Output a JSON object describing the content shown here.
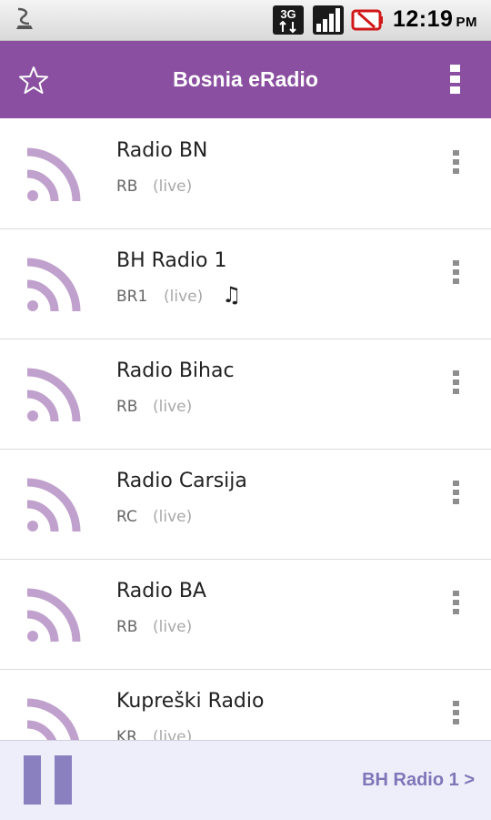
{
  "status_bar": {
    "time": "12:19",
    "ampm": "PM",
    "network": "3G"
  },
  "action_bar": {
    "title": "Bosnia eRadio",
    "accent_color": "#8a4fa0"
  },
  "stations": [
    {
      "name": "Radio BN",
      "code": "RB",
      "status": "(live)",
      "playing": false
    },
    {
      "name": "BH Radio 1",
      "code": "BR1",
      "status": "(live)",
      "playing": true,
      "playing_glyph": "♫"
    },
    {
      "name": "Radio Bihac",
      "code": "RB",
      "status": "(live)",
      "playing": false
    },
    {
      "name": "Radio Carsija",
      "code": "RC",
      "status": "(live)",
      "playing": false
    },
    {
      "name": "Radio BA",
      "code": "RB",
      "status": "(live)",
      "playing": false
    },
    {
      "name": "Kupreški Radio",
      "code": "KR",
      "status": "(live)",
      "playing": false
    }
  ],
  "player": {
    "now_playing": "BH Radio 1 >",
    "accent_color": "#8a80c0"
  },
  "icons": {
    "station": "rss-feed-icon",
    "overflow": "overflow-menu-icon",
    "favorite": "star-outline-icon"
  }
}
